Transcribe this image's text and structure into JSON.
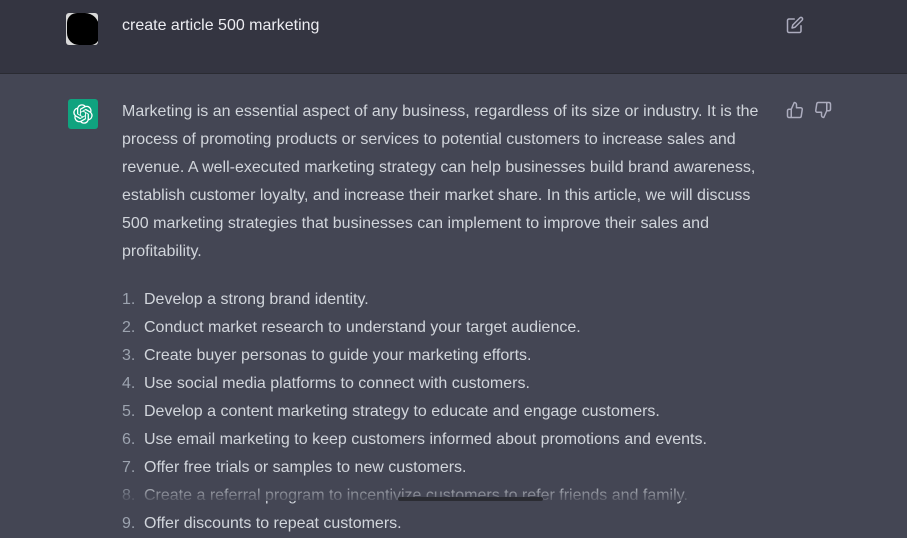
{
  "user_message": {
    "text": "create article 500 marketing"
  },
  "assistant_message": {
    "intro": "Marketing is an essential aspect of any business, regardless of its size or industry. It is the process of promoting products or services to potential customers to increase sales and revenue. A well-executed marketing strategy can help businesses build brand awareness, establish customer loyalty, and increase their market share. In this article, we will discuss 500 marketing strategies that businesses can implement to improve their sales and profitability.",
    "items": [
      {
        "num": "1.",
        "text": "Develop a strong brand identity."
      },
      {
        "num": "2.",
        "text": "Conduct market research to understand your target audience."
      },
      {
        "num": "3.",
        "text": "Create buyer personas to guide your marketing efforts."
      },
      {
        "num": "4.",
        "text": "Use social media platforms to connect with customers."
      },
      {
        "num": "5.",
        "text": "Develop a content marketing strategy to educate and engage customers."
      },
      {
        "num": "6.",
        "text": "Use email marketing to keep customers informed about promotions and events."
      },
      {
        "num": "7.",
        "text": "Offer free trials or samples to new customers."
      },
      {
        "num": "8.",
        "text": "Create a referral program to incentivize customers to refer friends and family."
      },
      {
        "num": "9.",
        "text": "Offer discounts to repeat customers."
      }
    ]
  },
  "icons": {
    "edit": "edit-icon",
    "thumbs_up": "thumbs-up-icon",
    "thumbs_down": "thumbs-down-icon",
    "assistant_logo": "openai-logo-icon"
  },
  "colors": {
    "user_bg": "#343541",
    "assistant_bg": "#444654",
    "assistant_avatar": "#10a37f"
  }
}
